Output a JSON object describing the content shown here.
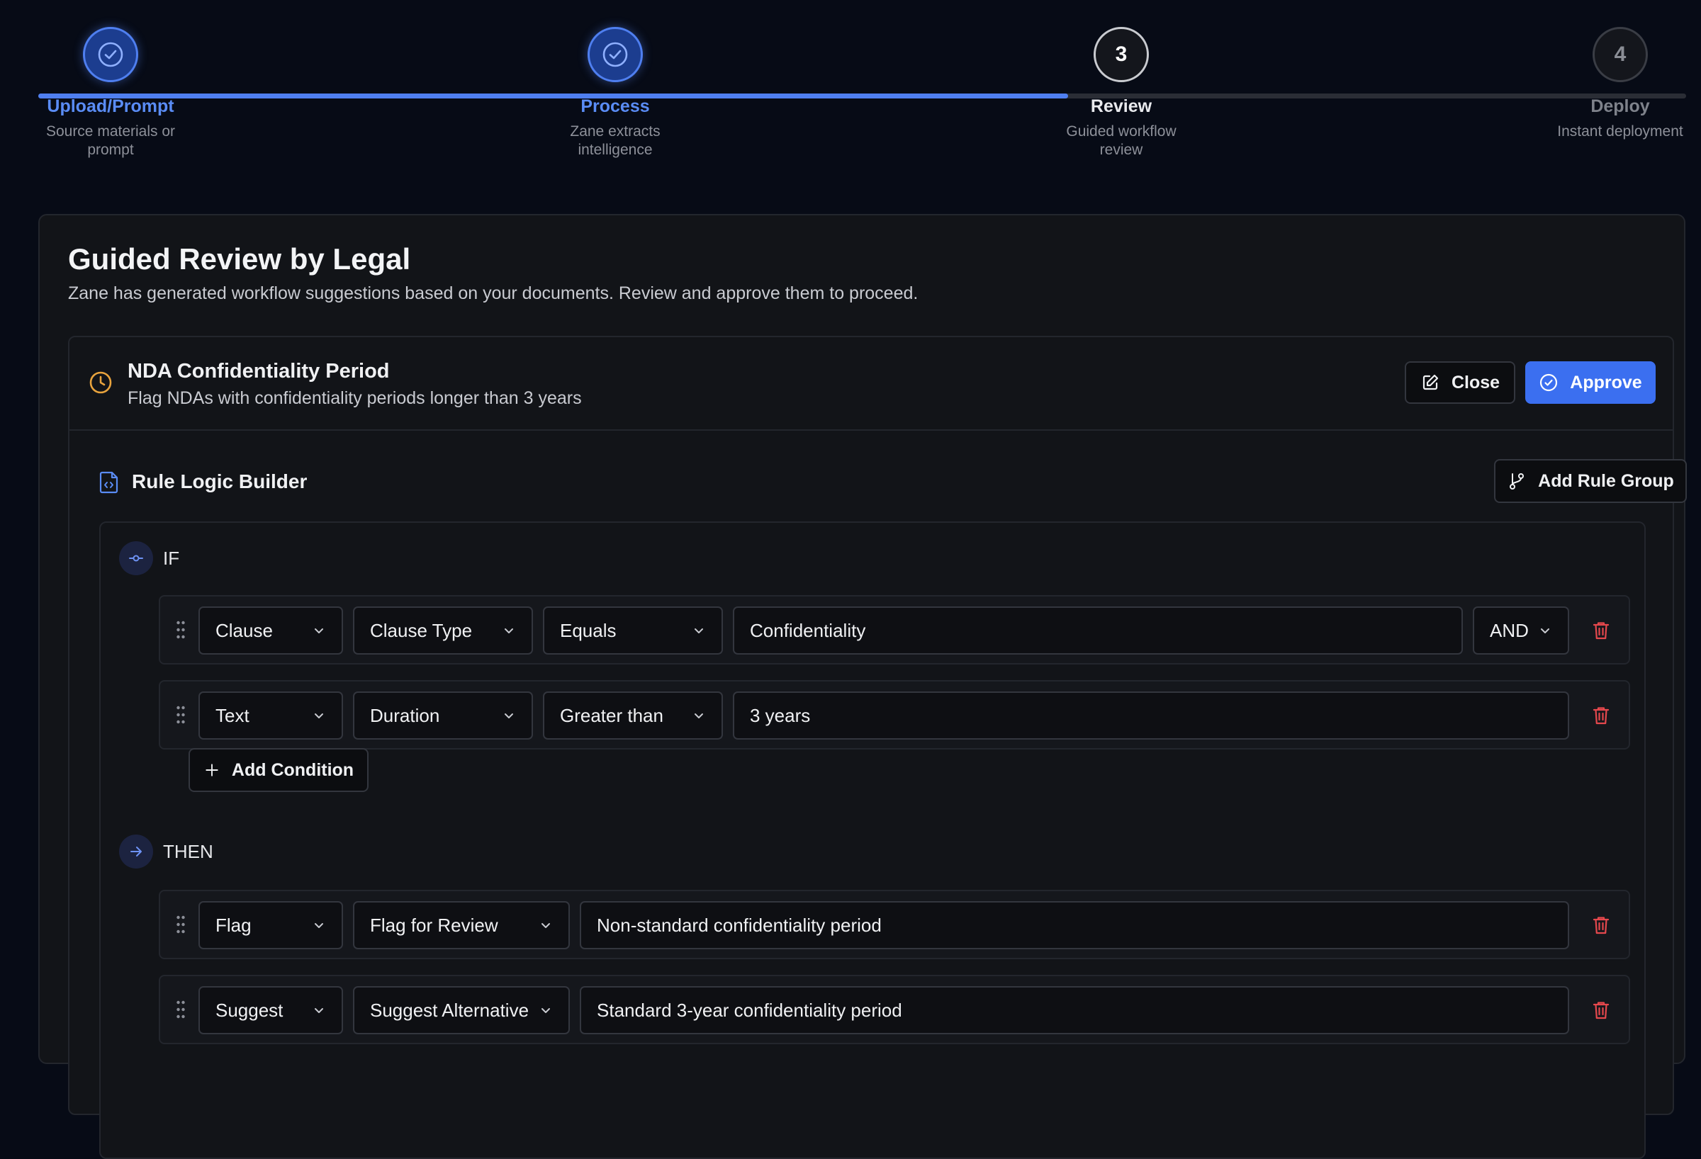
{
  "stepper": {
    "steps": [
      {
        "label": "Upload/Prompt",
        "desc_line1": "Source materials or",
        "desc_line2": "prompt",
        "state": "done",
        "number": ""
      },
      {
        "label": "Process",
        "desc_line1": "Zane extracts",
        "desc_line2": "intelligence",
        "state": "done",
        "number": ""
      },
      {
        "label": "Review",
        "desc_line1": "Guided workflow",
        "desc_line2": "review",
        "state": "current",
        "number": "3"
      },
      {
        "label": "Deploy",
        "desc_line1": "Instant deployment",
        "desc_line2": "",
        "state": "todo",
        "number": "4"
      }
    ],
    "progress_fraction": 0.625
  },
  "review": {
    "title": "Guided Review by Legal",
    "subtitle": "Zane has generated workflow suggestions based on your documents. Review and approve them to proceed."
  },
  "rule": {
    "title": "NDA Confidentiality Period",
    "description": "Flag NDAs with confidentiality periods longer than 3 years",
    "close_label": "Close",
    "approve_label": "Approve"
  },
  "builder": {
    "title": "Rule Logic Builder",
    "add_group_label": "Add Rule Group",
    "if_label": "IF",
    "then_label": "THEN",
    "add_condition_label": "Add Condition",
    "conditions": [
      {
        "field": "Clause",
        "attribute": "Clause Type",
        "operator": "Equals",
        "value": "Confidentiality",
        "joiner": "AND"
      },
      {
        "field": "Text",
        "attribute": "Duration",
        "operator": "Greater than",
        "value": "3 years"
      }
    ],
    "actions": [
      {
        "type": "Flag",
        "action": "Flag for Review",
        "value": "Non-standard confidentiality period"
      },
      {
        "type": "Suggest",
        "action": "Suggest Alternative",
        "value": "Standard 3-year confidentiality period"
      }
    ]
  },
  "colors": {
    "accent": "#3b6ff0",
    "step_done": "#5a8cf5",
    "warning_icon": "#e8a33d",
    "danger_icon": "#e5484d"
  }
}
